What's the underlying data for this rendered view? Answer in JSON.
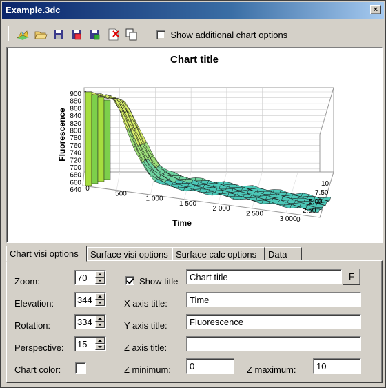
{
  "window": {
    "title": "Example.3dc",
    "close_glyph": "×"
  },
  "toolbar": {
    "buttons": [
      {
        "name": "chart-icon"
      },
      {
        "name": "open-folder-icon"
      },
      {
        "name": "save-icon"
      },
      {
        "name": "save-image-icon"
      },
      {
        "name": "export-icon"
      },
      {
        "name": "delete-icon"
      },
      {
        "name": "copy-icon"
      }
    ],
    "show_options_label": "Show additional chart options",
    "show_options_checked": false
  },
  "chart": {
    "title": "Chart title",
    "y_axis_label": "Fluorescence",
    "x_axis_label": "Time",
    "y_ticks": [
      "900",
      "880",
      "860",
      "840",
      "820",
      "800",
      "780",
      "760",
      "740",
      "720",
      "700",
      "680",
      "660",
      "640"
    ],
    "x_ticks": [
      "0",
      "500",
      "1 000",
      "1 500",
      "2 000",
      "2 500",
      "3 000"
    ],
    "z_ticks": [
      "0",
      "2.50",
      "5.00",
      "7.50",
      "10"
    ]
  },
  "tabs": [
    "Chart visi options",
    "Surface visi options",
    "Surface calc options",
    "Data"
  ],
  "active_tab": 0,
  "form": {
    "zoom_label": "Zoom:",
    "zoom_value": "70",
    "elevation_label": "Elevation:",
    "elevation_value": "344",
    "rotation_label": "Rotation:",
    "rotation_value": "334",
    "perspective_label": "Perspective:",
    "perspective_value": "15",
    "chart_color_label": "Chart color:",
    "show_title_label": "Show title",
    "show_title_checked": true,
    "title_value": "Chart title",
    "font_button": "F",
    "x_axis_title_label": "X axis title:",
    "x_axis_title_value": "Time",
    "y_axis_title_label": "Y axis title:",
    "y_axis_title_value": "Fluorescence",
    "z_axis_title_label": "Z axis title:",
    "z_axis_title_value": "",
    "z_min_label": "Z minimum:",
    "z_min_value": "0",
    "z_max_label": "Z maximum:",
    "z_max_value": "10"
  }
}
